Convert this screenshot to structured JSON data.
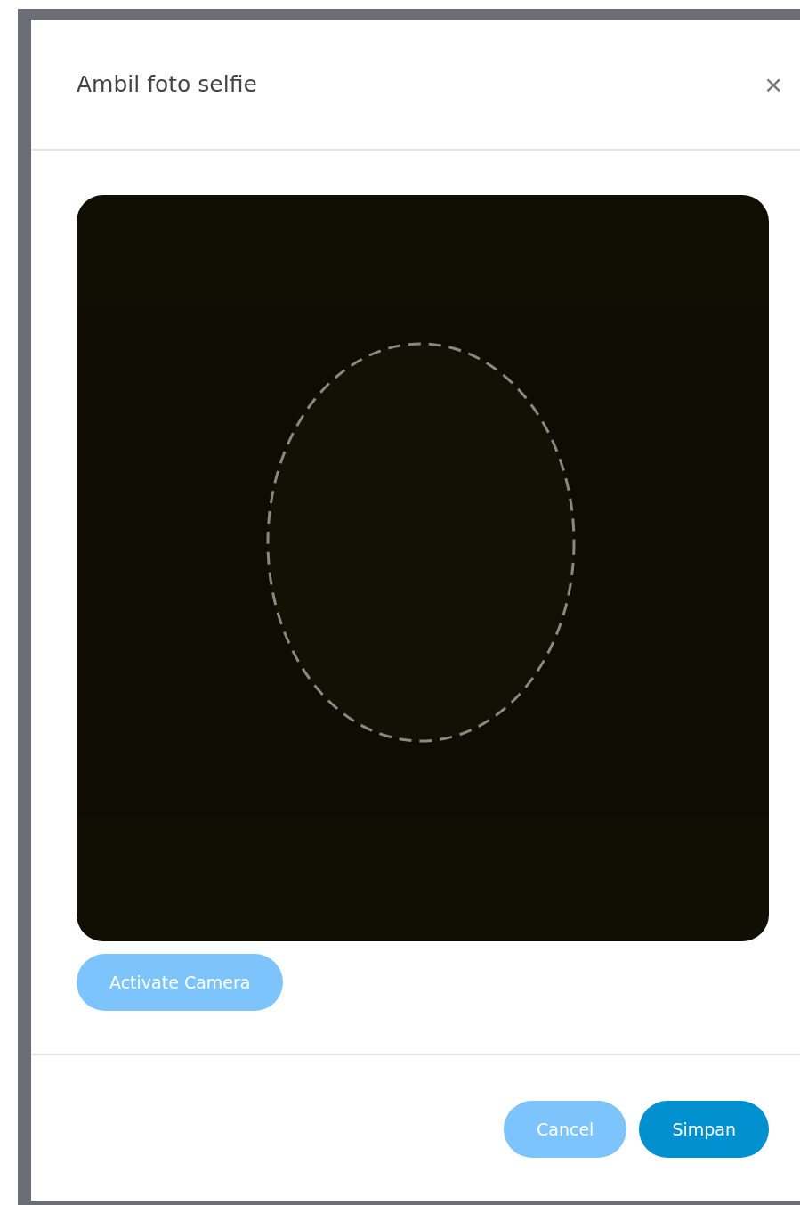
{
  "dialog": {
    "title": "Ambil foto selfie",
    "close_label": "×"
  },
  "camera": {
    "action": {
      "label": "Activate Camera",
      "kind": "light"
    }
  },
  "footer": {
    "buttons": [
      {
        "label": "Cancel",
        "kind": "light"
      },
      {
        "label": "Simpan",
        "kind": "primary"
      }
    ]
  }
}
